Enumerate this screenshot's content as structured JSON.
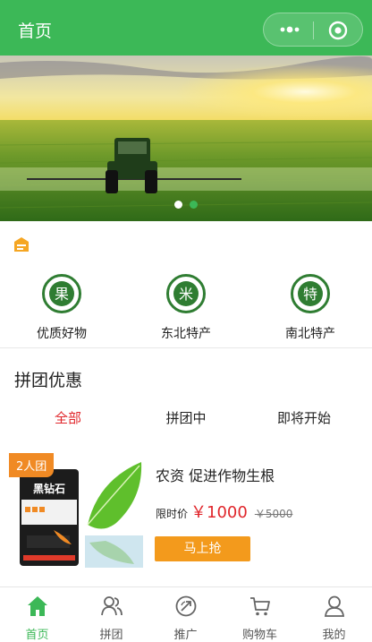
{
  "header": {
    "title": "首页"
  },
  "colors": {
    "brand": "#3cb857",
    "price": "#e0262b",
    "button": "#f39a1c",
    "tag": "#f08a24"
  },
  "banner": {
    "slide_count": 2,
    "active_index": 0
  },
  "categories": [
    {
      "label": "优质好物",
      "icon_char": "果"
    },
    {
      "label": "东北特产",
      "icon_char": "米"
    },
    {
      "label": "南北特产",
      "icon_char": "特"
    }
  ],
  "section": {
    "title": "拼团优惠"
  },
  "tabs": [
    {
      "label": "全部"
    },
    {
      "label": "拼团中"
    },
    {
      "label": "即将开始"
    }
  ],
  "product": {
    "tag": "2人团",
    "brand_text": "黑钻石",
    "name": "农资 促进作物生根",
    "price_label": "限时价",
    "price": "￥1000",
    "old_price": "￥5000",
    "buy_label": "马上抢"
  },
  "bottom_nav": [
    {
      "label": "首页",
      "icon": "home-icon"
    },
    {
      "label": "拼团",
      "icon": "group-icon"
    },
    {
      "label": "推广",
      "icon": "promote-icon"
    },
    {
      "label": "购物车",
      "icon": "cart-icon"
    },
    {
      "label": "我的",
      "icon": "user-icon"
    }
  ]
}
